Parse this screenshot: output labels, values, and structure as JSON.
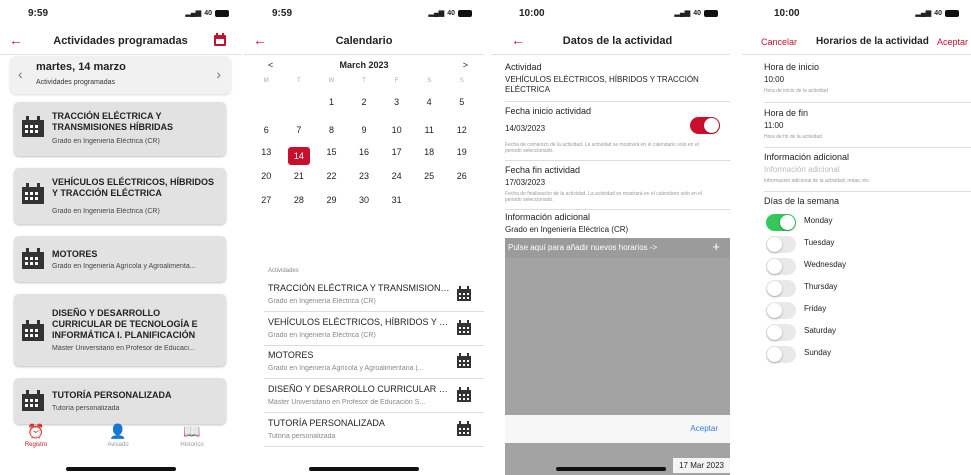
{
  "colors": {
    "brand": "#c8102e",
    "ios_blue": "#3478f6",
    "switch_green": "#34c759"
  },
  "screen1": {
    "time": "9:59",
    "signal": "40",
    "title": "Actividades programadas",
    "date": "martes, 14 marzo",
    "date_sub": "Actividades programadas",
    "cards": [
      {
        "title": "TRACCIÓN ELÉCTRICA Y TRANSMISIONES HÍBRIDAS",
        "sub": "Grado en Ingeniería Eléctrica (CR)"
      },
      {
        "title": "VEHÍCULOS ELÉCTRICOS, HÍBRIDOS Y TRACCIÓN ELÉCTRICA",
        "sub": "Grado en Ingeniería Eléctrica (CR)"
      },
      {
        "title": "MOTORES",
        "sub": "Grado en Ingeniería Agrícola y Agroalimenta..."
      },
      {
        "title": "DISEÑO Y DESARROLLO CURRICULAR DE TECNOLOGÍA E INFORMÁTICA I. PLANIFICACIÓN",
        "sub": "Máster Universitario en Profesor de Educaci..."
      },
      {
        "title": "TUTORÍA PERSONALIZADA",
        "sub": "Tutoría personalizada"
      }
    ],
    "tabs": [
      {
        "label": "Registro",
        "icon": "alarm-icon"
      },
      {
        "label": "Avisado",
        "icon": "person-icon"
      },
      {
        "label": "Historico",
        "icon": "book-icon"
      }
    ]
  },
  "screen2": {
    "time": "9:59",
    "signal": "40",
    "title": "Calendario",
    "month": "March 2023",
    "prev": "<",
    "next": ">",
    "weekdays": [
      "M",
      "T",
      "W",
      "T",
      "F",
      "S",
      "S"
    ],
    "weeks": [
      [
        "",
        "",
        "1",
        "2",
        "3",
        "4",
        "5"
      ],
      [
        "6",
        "7",
        "8",
        "9",
        "10",
        "11",
        "12"
      ],
      [
        "13",
        "14",
        "15",
        "16",
        "17",
        "18",
        "19"
      ],
      [
        "20",
        "21",
        "22",
        "23",
        "24",
        "25",
        "26"
      ],
      [
        "27",
        "28",
        "29",
        "30",
        "31",
        "",
        ""
      ]
    ],
    "selected_day": "14",
    "list_label": "Actividades",
    "activities": [
      {
        "title": "TRACCIÓN ELÉCTRICA Y TRANSMISIONES...",
        "sub": "Grado en Ingeniería Eléctrica (CR)"
      },
      {
        "title": "VEHÍCULOS ELÉCTRICOS, HÍBRIDOS Y TRA...",
        "sub": "Grado en Ingeniería Eléctrica (CR)"
      },
      {
        "title": "MOTORES",
        "sub": "Grado en Ingeniería Agrícola y Agroalimentaria (..."
      },
      {
        "title": "DISEÑO Y DESARROLLO CURRICULAR DE...",
        "sub": "Máster Universitario en Profesor de Educación S..."
      },
      {
        "title": "TUTORÍA PERSONALIZADA",
        "sub": "Tutoría personalizada"
      }
    ]
  },
  "screen3": {
    "time": "10:00",
    "signal": "40",
    "title": "Datos de la actividad",
    "actividad_label": "Actividad",
    "actividad_value": "VEHÍCULOS ELÉCTRICOS, HÍBRIDOS Y TRACCIÓN ELÉCTRICA",
    "fecha_inicio_label": "Fecha inicio actividad",
    "fecha_inicio_value": "14/03/2023",
    "fecha_inicio_hint": "Fecha de comienzo de la actividad. La actividad se mostrará en el calendario solo en el periodo seleccionado.",
    "fecha_inicio_toggle": true,
    "fecha_fin_label": "Fecha fin actividad",
    "fecha_fin_value": "17/03/2023",
    "fecha_fin_hint": "Fecha de finalización de la actividad. La actividad se mostrará en el calendario solo en el periodo seleccionado.",
    "info_label": "Información adicional",
    "info_value": "Grado en Ingeniería Eléctrica (CR)",
    "add_text": "Pulse aquí para añadir nuevos horarios ->",
    "add_plus": "+",
    "accept": "Aceptar",
    "date_pill": "17 Mar 2023"
  },
  "screen4": {
    "time": "10:00",
    "signal": "40",
    "cancel": "Cancelar",
    "title": "Horarios de la actividad",
    "accept": "Aceptar",
    "hora_inicio_label": "Hora de inicio",
    "hora_inicio_value": "10:00",
    "hora_inicio_hint": "Hora de inicio de la actividad",
    "hora_fin_label": "Hora de fin",
    "hora_fin_value": "11:00",
    "hora_fin_hint": "Hora de fin de la actividad",
    "info_label": "Información adicional",
    "info_placeholder": "Información adicional",
    "info_hint": "Información adicional de la actividad, notas, etc.",
    "days_label": "Días de la semana",
    "days": [
      {
        "name": "Monday",
        "on": true
      },
      {
        "name": "Tuesday",
        "on": false
      },
      {
        "name": "Wednesday",
        "on": false
      },
      {
        "name": "Thursday",
        "on": false
      },
      {
        "name": "Friday",
        "on": false
      },
      {
        "name": "Saturday",
        "on": false
      },
      {
        "name": "Sunday",
        "on": false
      }
    ]
  }
}
